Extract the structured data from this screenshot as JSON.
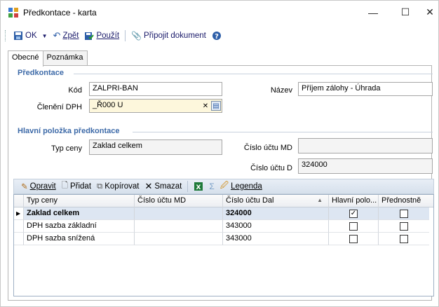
{
  "window": {
    "title": "Předkontace - karta",
    "min": "—",
    "max": "☐",
    "close": "✕"
  },
  "toolbar": {
    "ok": "OK",
    "back": "Zpět",
    "apply": "Použít",
    "attach": "Připojit dokument"
  },
  "tabs": [
    "Obecné",
    "Poznámka"
  ],
  "predkontace": {
    "group": "Předkontace",
    "kod_label": "Kód",
    "kod_value": "ZALPRI-BAN",
    "nazev_label": "Název",
    "nazev_value": "Příjem zálohy - Úhrada",
    "cleneni_label": "Členění DPH",
    "cleneni_value": "_Ř000 U"
  },
  "hlavni": {
    "group": "Hlavní položka předkontace",
    "typ_label": "Typ ceny",
    "typ_value": "Zaklad celkem",
    "md_label": "Číslo účtu MD",
    "md_value": "",
    "d_label": "Číslo účtu D",
    "d_value": "324000"
  },
  "grid_toolbar": {
    "edit": "Opravit",
    "add": "Přidat",
    "copy": "Kopírovat",
    "delete": "Smazat",
    "legend": "Legenda"
  },
  "grid": {
    "columns": [
      "Typ ceny",
      "Číslo účtu MD",
      "Číslo účtu Dal",
      "Hlavní polo...",
      "Přednostně"
    ],
    "rows": [
      {
        "typ": "Zaklad celkem",
        "md": "",
        "dal": "324000",
        "hlavni": true,
        "prednostne": false
      },
      {
        "typ": "DPH sazba základní",
        "md": "",
        "dal": "343000",
        "hlavni": false,
        "prednostne": false
      },
      {
        "typ": "DPH sazba snížená",
        "md": "",
        "dal": "343000",
        "hlavni": false,
        "prednostne": false
      }
    ]
  }
}
